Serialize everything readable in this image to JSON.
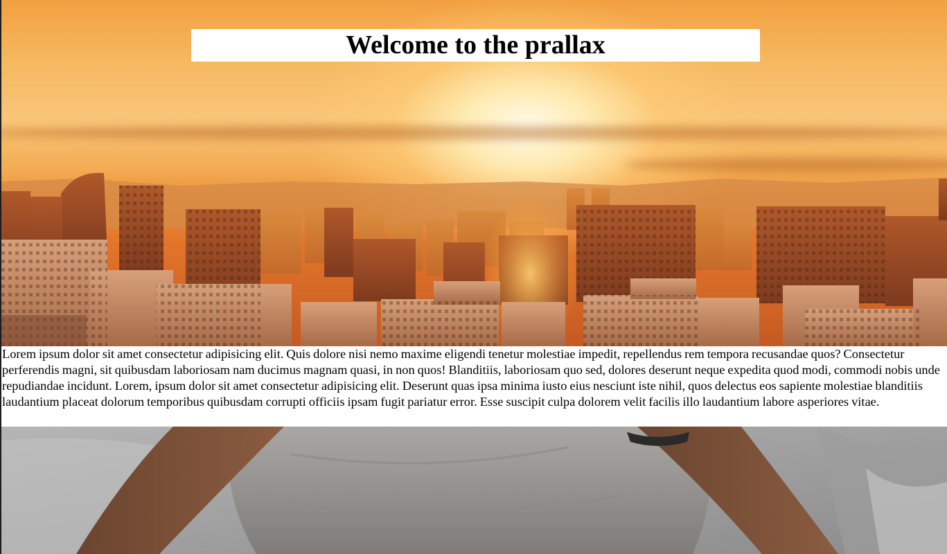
{
  "hero": {
    "title": "Welcome to the prallax"
  },
  "content": {
    "paragraph": "Lorem ipsum dolor sit amet consectetur adipisicing elit. Quis dolore nisi nemo maxime eligendi tenetur molestiae impedit, repellendus rem tempora recusandae quos? Consectetur perferendis magni, sit quibusdam laboriosam nam ducimus magnam quasi, in non quos! Blanditiis, laboriosam quo sed, dolores deserunt neque expedita quod modi, commodi nobis unde repudiandae incidunt. Lorem, ipsum dolor sit amet consectetur adipisicing elit. Deserunt quas ipsa minima iusto eius nesciunt iste nihil, quos delectus eos sapiente molestiae blanditiis laudantium placeat dolorum temporibus quibusdam corrupti officiis ipsam fugit pariatur error. Esse suscipit culpa dolorem velit facilis illo laudantium labore asperiores vitae."
  },
  "colors": {
    "title_background": "#ffffff",
    "text_background": "#ffffff",
    "sky_glow": "#fff6da",
    "sunset_orange": "#ec8f34"
  }
}
